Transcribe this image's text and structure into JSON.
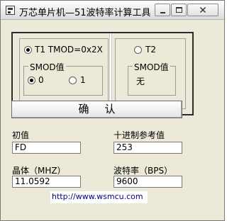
{
  "window": {
    "title": "万芯单片机—51波特率计算工具"
  },
  "timer_group": {
    "t1_label": "T1 TMOD=0x2X",
    "t1_selected": true,
    "t2_label": "T2",
    "t2_selected": false,
    "smod_left": {
      "title": "SMOD值",
      "option0_label": "0",
      "option0_selected": true,
      "option1_label": "1",
      "option1_selected": false
    },
    "smod_right": {
      "title": "SMOD值",
      "value": "无"
    }
  },
  "confirm_label": "确认",
  "fields": {
    "initial_label": "初值",
    "initial_value": "FD",
    "decimal_label": "十进制参考值",
    "decimal_value": "253",
    "crystal_label": "晶体（MHZ）",
    "crystal_value": "11.0592",
    "baud_label": "波特率（BPS）",
    "baud_value": "9600"
  },
  "footer": {
    "url": "http://www.wsmcu.com"
  }
}
